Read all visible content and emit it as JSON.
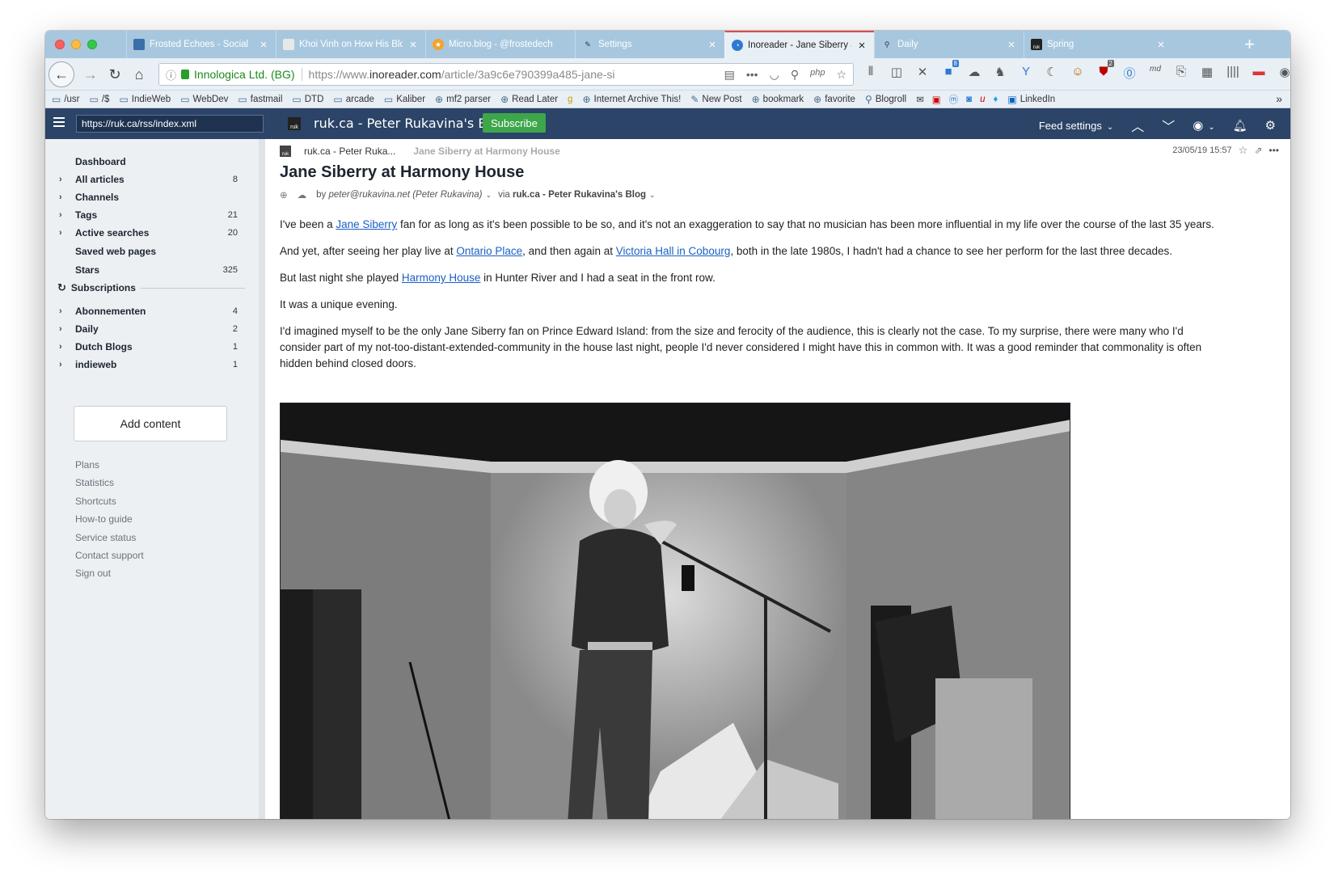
{
  "browser": {
    "tabs": [
      {
        "label": "Frosted Echoes - Social"
      },
      {
        "label": "Khoi Vinh on How His Blo"
      },
      {
        "label": "Micro.blog - @frostedech"
      },
      {
        "label": "Settings"
      },
      {
        "label": "Inoreader - Jane Siberry a"
      },
      {
        "label": "Daily"
      },
      {
        "label": "Spring"
      }
    ],
    "site_identity": "Innologica Ltd. (BG)",
    "url_prefix": "https://www.",
    "url_domain": "inoreader.com",
    "url_path": "/article/3a9c6e790399a485-jane-si",
    "bookmarks": [
      {
        "label": "/usr"
      },
      {
        "label": "/$"
      },
      {
        "label": "IndieWeb"
      },
      {
        "label": "WebDev"
      },
      {
        "label": "fastmail"
      },
      {
        "label": "DTD"
      },
      {
        "label": "arcade"
      },
      {
        "label": "Kaliber"
      },
      {
        "label": "mf2 parser"
      },
      {
        "label": "Read Later"
      },
      {
        "label": "g"
      },
      {
        "label": "Internet Archive This!"
      },
      {
        "label": "New Post"
      },
      {
        "label": "bookmark"
      },
      {
        "label": "favorite"
      },
      {
        "label": "Blogroll"
      },
      {
        "label": "LinkedIn"
      }
    ],
    "ext_badge_1": "8",
    "ext_badge_2": "2"
  },
  "app": {
    "search_value": "https://ruk.ca/rss/index.xml",
    "feed_logo_text": "ruk",
    "feed_title": "ruk.ca - Peter Rukavina's Blog",
    "subscribe_label": "Subscribe",
    "feed_settings_label": "Feed settings"
  },
  "sidebar": {
    "items": [
      {
        "label": "Dashboard",
        "count": ""
      },
      {
        "label": "All articles",
        "count": "8"
      },
      {
        "label": "Channels",
        "count": ""
      },
      {
        "label": "Tags",
        "count": "21"
      },
      {
        "label": "Active searches",
        "count": "20"
      },
      {
        "label": "Saved web pages",
        "count": ""
      },
      {
        "label": "Stars",
        "count": "325"
      }
    ],
    "subscriptions_label": "Subscriptions",
    "folders": [
      {
        "label": "Abonnementen",
        "count": "4"
      },
      {
        "label": "Daily",
        "count": "2"
      },
      {
        "label": "Dutch Blogs",
        "count": "1"
      },
      {
        "label": "indieweb",
        "count": "1"
      }
    ],
    "add_content_label": "Add content",
    "footer_links": [
      "Plans",
      "Statistics",
      "Shortcuts",
      "How-to guide",
      "Service status",
      "Contact support",
      "Sign out"
    ]
  },
  "article": {
    "source": "ruk.ca - Peter Ruka...",
    "ghost_title": "Jane Siberry at Harmony House",
    "timestamp": "23/05/19 15:57",
    "title": "Jane Siberry at Harmony House",
    "by_prefix": "by",
    "author": "peter@rukavina.net (Peter Rukavina)",
    "via_prefix": "via",
    "via_feed": "ruk.ca - Peter Rukavina's Blog",
    "p1_a": "I've been a ",
    "p1_link": "Jane Siberry",
    "p1_b": " fan for as long as it's been possible to be so, and it's not an exaggeration to say that no musician has been more influential in my life over the course of the last 35 years.",
    "p2_a": "And yet, after seeing her play live at ",
    "p2_link1": "Ontario Place",
    "p2_b": ", and then again at ",
    "p2_link2": "Victoria Hall in Cobourg",
    "p2_c": ", both in the late 1980s, I hadn't had a chance to see her perform for the last three decades.",
    "p3_a": "But last night she played ",
    "p3_link": "Harmony House",
    "p3_b": " in Hunter River and I had a seat in the front row.",
    "p4": "It was a unique evening.",
    "p5": "I'd imagined myself to be the only Jane Siberry fan on Prince Edward Island: from the size and ferocity of the audience, this is clearly not the case. To my surprise, there were many who I'd consider part of my not-too-distant-extended-community in the house last night, people I'd never considered I might have this in common with. It was a good reminder that commonality is often hidden behind closed doors."
  },
  "colors": {
    "tabstrip": "#a7c7df",
    "app_header": "#2b4467",
    "subscribe": "#3ea64a",
    "link": "#1a5fc4"
  }
}
